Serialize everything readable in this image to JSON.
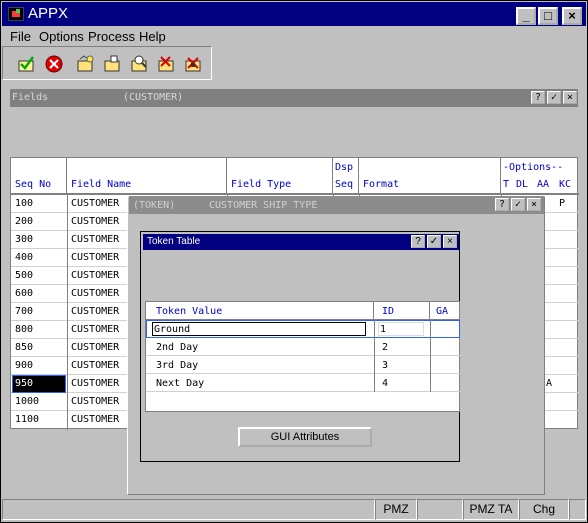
{
  "app": {
    "title": "APPX",
    "window_controls": [
      "_",
      "□",
      "×"
    ]
  },
  "menu": [
    "File",
    "Options",
    "Process",
    "Help"
  ],
  "fields_window": {
    "title": "Fields",
    "subtitle": "(CUSTOMER)"
  },
  "grid": {
    "headers": {
      "seq_no": "Seq No",
      "field_name": "Field Name",
      "field_type": "Field Type",
      "dsp": "Dsp",
      "seq": "Seq",
      "format": "Format",
      "options": "-Options--",
      "t": "T",
      "dl": "DL",
      "aa": "AA",
      "kc": "KC"
    },
    "rows": [
      {
        "seq": "100",
        "name": "CUSTOMER",
        "kc": "P"
      },
      {
        "seq": "200",
        "name": "CUSTOMER"
      },
      {
        "seq": "300",
        "name": "CUSTOMER"
      },
      {
        "seq": "400",
        "name": "CUSTOMER"
      },
      {
        "seq": "500",
        "name": "CUSTOMER"
      },
      {
        "seq": "600",
        "name": "CUSTOMER"
      },
      {
        "seq": "700",
        "name": "CUSTOMER"
      },
      {
        "seq": "800",
        "name": "CUSTOMER"
      },
      {
        "seq": "850",
        "name": "CUSTOMER"
      },
      {
        "seq": "900",
        "name": "CUSTOMER"
      },
      {
        "seq": "950",
        "name": "CUSTOMER",
        "aa": "A"
      },
      {
        "seq": "1000",
        "name": "CUSTOMER"
      },
      {
        "seq": "1100",
        "name": "CUSTOMER"
      }
    ]
  },
  "token_window": {
    "title": "(TOKEN)",
    "subtitle": "CUSTOMER SHIP TYPE"
  },
  "token_table": {
    "title": "Token Table",
    "headers": {
      "token_value": "Token Value",
      "id": "ID",
      "ga": "GA"
    },
    "rows": [
      {
        "value": "Ground",
        "id": "1"
      },
      {
        "value": "2nd Day",
        "id": "2"
      },
      {
        "value": "3rd Day",
        "id": "3"
      },
      {
        "value": "Next Day",
        "id": "4"
      }
    ],
    "gui_button": "GUI Attributes"
  },
  "status": [
    "PMZ",
    "PMZ TA",
    "Chg"
  ]
}
